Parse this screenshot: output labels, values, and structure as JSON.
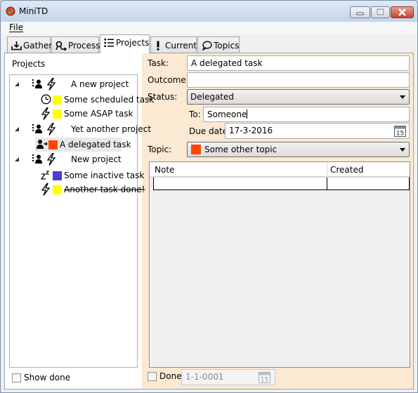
{
  "window": {
    "title": "MiniTD"
  },
  "menu": {
    "file": "File"
  },
  "tabs": [
    {
      "label": "Gather",
      "icon": "inbox-down-icon"
    },
    {
      "label": "Process",
      "icon": "process-icon"
    },
    {
      "label": "Projects",
      "icon": "list-icon",
      "active": true
    },
    {
      "label": "Current",
      "icon": "exclamation-icon"
    },
    {
      "label": "Topics",
      "icon": "speech-bubble-icon"
    }
  ],
  "projects_panel": {
    "header": "Projects",
    "tree": [
      {
        "label": "A new project",
        "type": "project"
      },
      {
        "label": "Some scheduled task",
        "type": "task",
        "icon": "clock-icon",
        "color": "#ffff00"
      },
      {
        "label": "Some ASAP task",
        "type": "task",
        "icon": "lightning-icon",
        "color": "#ffff00"
      },
      {
        "label": "Yet another project",
        "type": "project"
      },
      {
        "label": "A delegated task",
        "type": "task",
        "icon": "delegate-person-icon",
        "color": "#ff4500",
        "selected": true
      },
      {
        "label": "New project",
        "type": "project"
      },
      {
        "label": "Some inactive task",
        "type": "task",
        "icon": "sleep-icon",
        "color": "#4b3cd6"
      },
      {
        "label": "Another task done!",
        "type": "task",
        "icon": "lightning-icon",
        "color": "#ffff00",
        "done": true
      }
    ],
    "show_done_label": "Show done"
  },
  "details": {
    "task_label": "Task:",
    "task_value": "A delegated task",
    "outcome_label": "Outcome:",
    "outcome_value": "",
    "status_label": "Status:",
    "status_value": "Delegated",
    "to_label": "To:",
    "to_value": "Someone",
    "due_label": "Due date:",
    "due_value": "17-3-2016",
    "topic_label": "Topic:",
    "topic_value": "Some other topic",
    "topic_color": "#ff4500",
    "calendar_day": "15"
  },
  "notes_grid": {
    "columns": [
      "Note",
      "Created"
    ]
  },
  "bottom": {
    "done_label": "Done",
    "done_date": "1-1-0001"
  }
}
